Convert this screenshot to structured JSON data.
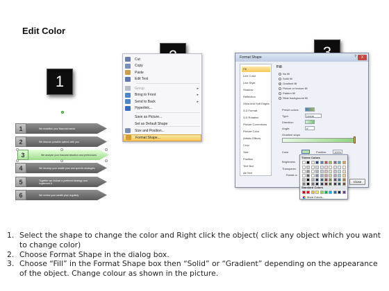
{
  "page": {
    "title": "Edit Color"
  },
  "badges": [
    "1",
    "2",
    "3"
  ],
  "step1": {
    "rows": [
      {
        "num": "1",
        "text": "We establish your financial needs",
        "selected": false
      },
      {
        "num": "2",
        "text": "We discuss possible options with you",
        "selected": false
      },
      {
        "num": "3",
        "text": "We analyze your financial situation and preferences",
        "selected": true
      },
      {
        "num": "4",
        "text": "We develop your wealth plan and specific strategies",
        "selected": false
      },
      {
        "num": "5",
        "text": "Together we choose a preferred strategy and implement it",
        "selected": false
      },
      {
        "num": "6",
        "text": "We review your wealth plan regularly",
        "selected": false
      }
    ]
  },
  "step2": {
    "menu": [
      {
        "label": "Cut",
        "icon": "scissors-icon",
        "color": "#6a7ea8",
        "dim": false,
        "arrow": false,
        "hl": false
      },
      {
        "label": "Copy",
        "icon": "copy-icon",
        "color": "#7c8fbc",
        "dim": false,
        "arrow": false,
        "hl": false
      },
      {
        "label": "Paste",
        "icon": "paste-icon",
        "color": "#c8a04a",
        "dim": false,
        "arrow": false,
        "hl": false
      },
      {
        "label": "Edit Text",
        "icon": "edit-text-icon",
        "color": "#5c77b0",
        "dim": false,
        "arrow": false,
        "hl": false
      },
      {
        "label": "Group",
        "icon": "group-icon",
        "color": "#b8bcc8",
        "dim": true,
        "arrow": true,
        "hl": false
      },
      {
        "label": "Bring to Front",
        "icon": "bring-front-icon",
        "color": "#4f86c6",
        "dim": false,
        "arrow": true,
        "hl": false
      },
      {
        "label": "Send to Back",
        "icon": "send-back-icon",
        "color": "#4f86c6",
        "dim": false,
        "arrow": true,
        "hl": false
      },
      {
        "label": "Hyperlink...",
        "icon": "hyperlink-icon",
        "color": "#3a6cc0",
        "dim": false,
        "arrow": false,
        "hl": false
      },
      {
        "label": "Save as Picture...",
        "icon": "",
        "color": "",
        "dim": false,
        "arrow": false,
        "hl": false
      },
      {
        "label": "Set as Default Shape",
        "icon": "",
        "color": "",
        "dim": false,
        "arrow": false,
        "hl": false
      },
      {
        "label": "Size and Position...",
        "icon": "size-position-icon",
        "color": "#7a8fb8",
        "dim": false,
        "arrow": false,
        "hl": false
      },
      {
        "label": "Format Shape...",
        "icon": "format-shape-icon",
        "color": "#d89b34",
        "dim": false,
        "arrow": false,
        "hl": true
      }
    ]
  },
  "step3": {
    "dialog_title": "Format Shape",
    "help": "?",
    "close_x": "X",
    "categories": [
      "Fill",
      "Line Color",
      "Line Style",
      "Shadow",
      "Reflection",
      "Glow and Soft Edges",
      "3-D Format",
      "3-D Rotation",
      "Picture Corrections",
      "Picture Color",
      "Artistic Effects",
      "Crop",
      "Size",
      "Position",
      "Text Box",
      "Alt Text"
    ],
    "pane_title": "Fill",
    "fill_options": [
      "No fill",
      "Solid fill",
      "Gradient fill",
      "Picture or texture fill",
      "Pattern fill",
      "Slide background fill"
    ],
    "selected_fill": "Gradient fill",
    "fields": {
      "preset": "Preset colors:",
      "type": "Type:",
      "type_value": "Linear",
      "direction": "Direction:",
      "angle": "Angle:",
      "angle_value": "0°",
      "stops": "Gradient stops",
      "color": "Color",
      "position": "Position:",
      "position_value": "100%",
      "brightness": "Brightness",
      "transparency": "Transparen",
      "rotate": "Rotate w"
    },
    "close_button": "Close",
    "palette": {
      "theme_header": "Theme Colors",
      "standard_header": "Standard Colors",
      "more": "More Colors...",
      "theme_top": [
        "#ffffff",
        "#000000",
        "#eeece1",
        "#1f497d",
        "#4f81bd",
        "#c0504d",
        "#9bbb59",
        "#8064a2",
        "#4bacc6",
        "#f79646"
      ],
      "standard": [
        "#c00000",
        "#ff0000",
        "#ffc000",
        "#ffff00",
        "#92d050",
        "#00b050",
        "#00b0f0",
        "#0070c0",
        "#002060",
        "#7030a0"
      ]
    }
  },
  "instructions": [
    {
      "num": "1.",
      "text": "Select the shape to change the color and Right click the object( click any object which you want to change color)"
    },
    {
      "num": "2.",
      "text": "Choose Format Shape in the dialog box."
    },
    {
      "num": "3.",
      "text": "Choose “Fill” in the Format Shape box then “Solid” or “Gradient” depending on the appearance of the object. Change colour as shown in the picture."
    }
  ]
}
